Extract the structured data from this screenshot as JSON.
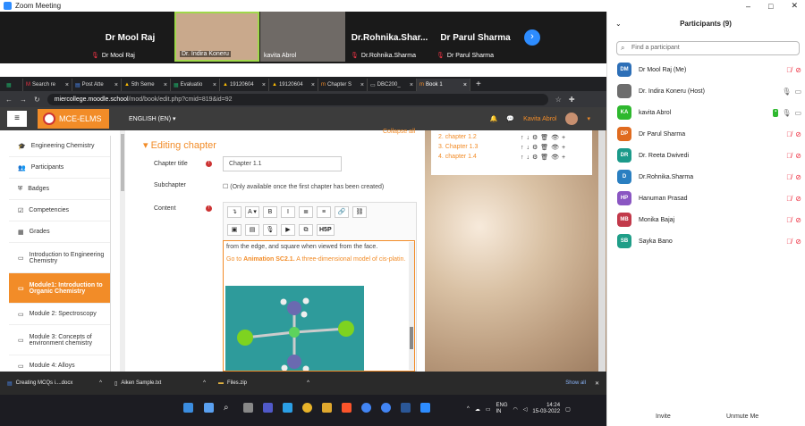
{
  "app": {
    "title": "Zoom Meeting"
  },
  "window_controls": {
    "minimize": "–",
    "maximize": "□",
    "close": "✕"
  },
  "gallery": {
    "tiles": [
      {
        "big": "Dr Mool Raj",
        "label": "Dr Mool Raj",
        "video": false
      },
      {
        "big": "",
        "label": "Dr. Indira Koneru",
        "video": true
      },
      {
        "big": "",
        "label": "kavita Abrol",
        "video": true
      },
      {
        "big": "Dr.Rohnika.Shar...",
        "label": "Dr.Rohnika.Sharma",
        "video": false
      },
      {
        "big": "Dr Parul Sharma",
        "label": "Dr Parul Sharma",
        "video": false
      }
    ],
    "next": "›"
  },
  "browser": {
    "tabs": [
      {
        "label": "",
        "icon": "sheets-icon"
      },
      {
        "label": "Search re",
        "icon": "gmail-icon"
      },
      {
        "label": "Post Atte",
        "icon": "docs-icon"
      },
      {
        "label": "5th Seme",
        "icon": "drive-icon"
      },
      {
        "label": "Evaluatio",
        "icon": "sheets-icon"
      },
      {
        "label": "19120604",
        "icon": "drive-icon"
      },
      {
        "label": "19120604",
        "icon": "drive-icon"
      },
      {
        "label": "Chapter S",
        "icon": "moodle-icon"
      },
      {
        "label": "DBC200_",
        "icon": "page-icon"
      },
      {
        "label": "Book 1",
        "icon": "moodle-icon",
        "active": true
      }
    ],
    "new_tab": "+",
    "url_host": "miercollege.moodle.school",
    "url_path": "/mod/book/edit.php?cmid=819&id=92"
  },
  "moodle": {
    "brand": "MCE-ELMS",
    "language": "ENGLISH (EN) ▾",
    "user": "Kavita Abrol",
    "sidebar": [
      {
        "label": "Engineering Chemistry",
        "icon": "graduation-cap-icon"
      },
      {
        "label": "Participants",
        "icon": "users-icon"
      },
      {
        "label": "Badges",
        "icon": "shield-icon"
      },
      {
        "label": "Competencies",
        "icon": "check-icon"
      },
      {
        "label": "Grades",
        "icon": "table-icon"
      },
      {
        "label": "Introduction to Engineering Chemistry",
        "icon": "folder-icon"
      },
      {
        "label": "Module1: Introduction to Organic Chemistry",
        "icon": "folder-icon",
        "active": true
      },
      {
        "label": "Module 2: Spectroscopy",
        "icon": "folder-icon"
      },
      {
        "label": "Module 3: Concepts of environment chemistry",
        "icon": "folder-icon"
      },
      {
        "label": "Module 4: Alloys",
        "icon": "folder-icon"
      }
    ],
    "collapse_all": "Collapse all",
    "heading": "Editing chapter",
    "form": {
      "title_label": "Chapter title",
      "title_value": "Chapter 1.1",
      "subchapter_label": "Subchapter",
      "subchapter_note": "(Only available once the first chapter has been created)",
      "content_label": "Content"
    },
    "toolbar_row1": [
      "↴",
      "A ▾",
      "B",
      "I",
      "≣",
      "≡",
      "🔗",
      "⛓"
    ],
    "toolbar_row2": [
      "▣",
      "▤",
      "🎙",
      "▶",
      "⧉",
      "H5P"
    ],
    "editor_text": {
      "line1": "from the edge, and square when viewed from the face.",
      "goto_prefix": "Go to ",
      "goto_bold": "Animation SC2.1.",
      "goto_rest": " A three-dimensional model of cis-platin."
    },
    "chapters": [
      {
        "label": "2. chapter 1.2"
      },
      {
        "label": "3. Chapter 1.3"
      },
      {
        "label": "4. chapter 1.4"
      }
    ],
    "chapter_actions": "↑↓⚙🗑👁+"
  },
  "downloads": {
    "items": [
      {
        "label": "Creating MCQs i....docx"
      },
      {
        "label": "Aiken Sample.txt"
      },
      {
        "label": "Files.zip"
      }
    ],
    "show_all": "Show all",
    "close": "✕"
  },
  "taskbar": {
    "lang_top": "ENG",
    "lang_bottom": "IN",
    "time": "14:24",
    "date": "15-03-2022"
  },
  "participants": {
    "title": "Participants (9)",
    "search_placeholder": "Find a participant",
    "list": [
      {
        "initials": "DM",
        "name": "Dr Mool Raj (Me)",
        "color": "#2d6fb7",
        "mic": "off",
        "video": "off"
      },
      {
        "initials": "",
        "name": "Dr. Indira Koneru (Host)",
        "color": "#6d6d6d",
        "mic": "on",
        "video": "on"
      },
      {
        "initials": "KA",
        "name": "kavita Abrol",
        "color": "#2eb82e",
        "mic": "on",
        "video": "on",
        "share": "▪"
      },
      {
        "initials": "DP",
        "name": "Dr Parul Sharma",
        "color": "#e06b1f",
        "mic": "off",
        "video": "off"
      },
      {
        "initials": "DR",
        "name": "Dr. Reeta Dwivedi",
        "color": "#1b9a8a",
        "mic": "off",
        "video": "off"
      },
      {
        "initials": "D",
        "name": "Dr.Rohnika.Sharma",
        "color": "#2a7fc1",
        "mic": "off",
        "video": "off"
      },
      {
        "initials": "HP",
        "name": "Hanuman Prasad",
        "color": "#8a56c2",
        "mic": "off",
        "video": "off"
      },
      {
        "initials": "MB",
        "name": "Monika Bajaj",
        "color": "#c2394a",
        "mic": "off",
        "video": "off"
      },
      {
        "initials": "SB",
        "name": "Sayka Bano",
        "color": "#1f9e88",
        "mic": "off",
        "video": "off"
      }
    ],
    "invite": "Invite",
    "unmute": "Unmute Me"
  }
}
